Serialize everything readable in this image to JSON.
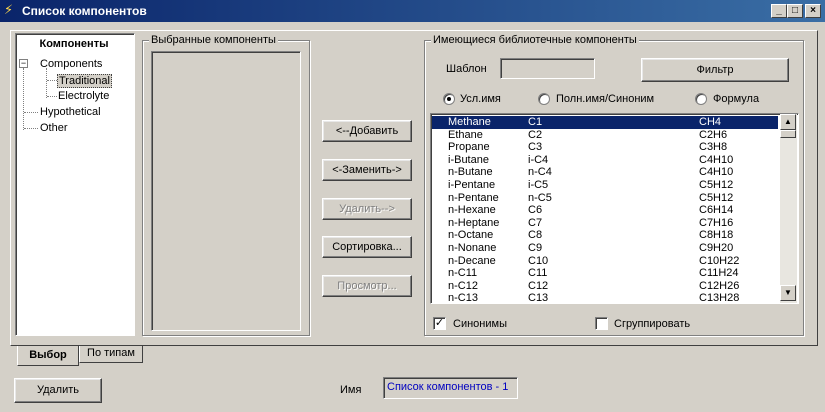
{
  "window": {
    "title": "Список компонентов",
    "min_glyph": "_",
    "max_glyph": "□",
    "close_glyph": "×"
  },
  "tree": {
    "header": "Компоненты",
    "root": "Components",
    "root_expander": "−",
    "children": [
      "Traditional",
      "Electrolyte"
    ],
    "selected_child": "Traditional",
    "siblings": [
      "Hypothetical",
      "Other"
    ]
  },
  "selected_group": {
    "title": "Выбранные компоненты"
  },
  "actions": {
    "add": "<--Добавить",
    "replace": "<-Заменить->",
    "remove": "Удалить-->",
    "sort": "Сортировка...",
    "preview": "Просмотр..."
  },
  "library": {
    "title": "Имеющиеся библиотечные компоненты",
    "template_label": "Шаблон",
    "template_value": "",
    "filter_button": "Фильтр",
    "radio_options": [
      "Усл.имя",
      "Полн.имя/Синоним",
      "Формула"
    ],
    "radio_selected": "Усл.имя",
    "rows": [
      [
        "Methane",
        "C1",
        "CH4"
      ],
      [
        "Ethane",
        "C2",
        "C2H6"
      ],
      [
        "Propane",
        "C3",
        "C3H8"
      ],
      [
        "i-Butane",
        "i-C4",
        "C4H10"
      ],
      [
        "n-Butane",
        "n-C4",
        "C4H10"
      ],
      [
        "i-Pentane",
        "i-C5",
        "C5H12"
      ],
      [
        "n-Pentane",
        "n-C5",
        "C5H12"
      ],
      [
        "n-Hexane",
        "C6",
        "C6H14"
      ],
      [
        "n-Heptane",
        "C7",
        "C7H16"
      ],
      [
        "n-Octane",
        "C8",
        "C8H18"
      ],
      [
        "n-Nonane",
        "C9",
        "C9H20"
      ],
      [
        "n-Decane",
        "C10",
        "C10H22"
      ],
      [
        "n-C11",
        "C11",
        "C11H24"
      ],
      [
        "n-C12",
        "C12",
        "C12H26"
      ],
      [
        "n-C13",
        "C13",
        "C13H28"
      ]
    ],
    "selected_row": 0,
    "synonyms_label": "Синонимы",
    "synonyms_checked": true,
    "group_label": "Сгруппировать",
    "group_checked": false,
    "scroll_up": "▲",
    "scroll_down": "▼"
  },
  "tabs": [
    "Выбор",
    "По типам"
  ],
  "active_tab": "Выбор",
  "footer": {
    "delete_button": "Удалить",
    "name_label": "Имя",
    "name_value": "Список компонентов - 1"
  },
  "colors": {
    "title_bar": "#0a246a",
    "selection": "#0a246a",
    "name_text": "#0000c0"
  },
  "check_glyph": "✓"
}
